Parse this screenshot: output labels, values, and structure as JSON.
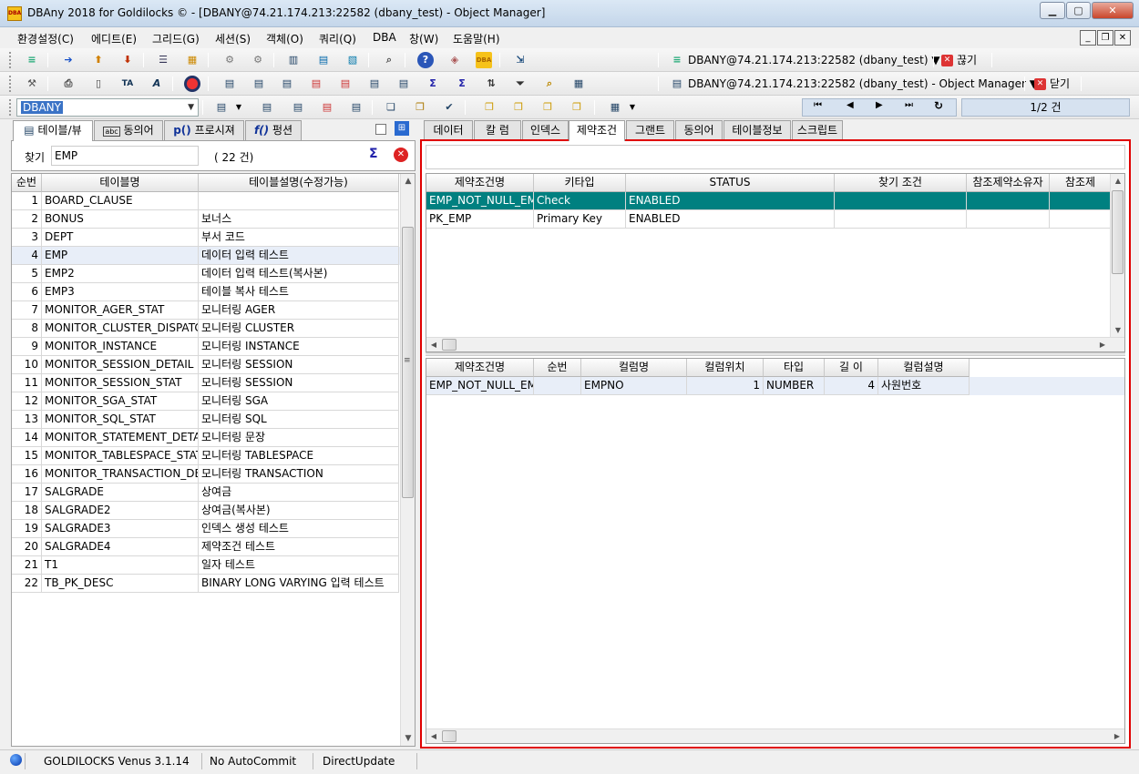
{
  "window": {
    "title": "DBAny 2018 for Goldilocks © - [DBANY@74.21.174.213:22582 (dbany_test) - Object Manager]",
    "app_icon_label": "DBA"
  },
  "menu": [
    "환경설정(C)",
    "에디트(E)",
    "그리드(G)",
    "세션(S)",
    "객체(O)",
    "쿼리(Q)",
    "DBA",
    "창(W)",
    "도움말(H)"
  ],
  "connection": {
    "session_label": "DBANY@74.21.174.213:22582 (dbany_test) ▼",
    "disconnect_label": "끊기",
    "window_label": "DBANY@74.21.174.213:22582 (dbany_test) - Object Manager ▼",
    "close_label": "닫기"
  },
  "schema_combo": {
    "value": "DBANY"
  },
  "pager": {
    "text": "1/2 건"
  },
  "left_tabs": [
    {
      "label": "테이블/뷰"
    },
    {
      "label": "동의어"
    },
    {
      "label": "프로시져"
    },
    {
      "label": "펑션"
    }
  ],
  "search": {
    "label": "찾기",
    "value": "EMP",
    "count": "( 22 건)"
  },
  "table_list": {
    "headers": [
      "순번",
      "테이블명",
      "테이블설명(수정가능)"
    ],
    "rows": [
      [
        "1",
        "BOARD_CLAUSE",
        ""
      ],
      [
        "2",
        "BONUS",
        "보너스"
      ],
      [
        "3",
        "DEPT",
        "부서 코드"
      ],
      [
        "4",
        "EMP",
        "데이터 입력 테스트"
      ],
      [
        "5",
        "EMP2",
        "데이터 입력 테스트(복사본)"
      ],
      [
        "6",
        "EMP3",
        "테이블 복사 테스트"
      ],
      [
        "7",
        "MONITOR_AGER_STAT",
        "모니터링 AGER"
      ],
      [
        "8",
        "MONITOR_CLUSTER_DISPATCH",
        "모니터링 CLUSTER"
      ],
      [
        "9",
        "MONITOR_INSTANCE",
        "모니터링 INSTANCE"
      ],
      [
        "10",
        "MONITOR_SESSION_DETAIL",
        "모니터링 SESSION"
      ],
      [
        "11",
        "MONITOR_SESSION_STAT",
        "모니터링 SESSION"
      ],
      [
        "12",
        "MONITOR_SGA_STAT",
        "모니터링 SGA"
      ],
      [
        "13",
        "MONITOR_SQL_STAT",
        "모니터링 SQL"
      ],
      [
        "14",
        "MONITOR_STATEMENT_DETAIL",
        "모니터링 문장"
      ],
      [
        "15",
        "MONITOR_TABLESPACE_STAT",
        "모니터링 TABLESPACE"
      ],
      [
        "16",
        "MONITOR_TRANSACTION_DETA",
        "모니터링 TRANSACTION"
      ],
      [
        "17",
        "SALGRADE",
        "상여금"
      ],
      [
        "18",
        "SALGRADE2",
        "상여금(복사본)"
      ],
      [
        "19",
        "SALGRADE3",
        "인덱스 생성 테스트"
      ],
      [
        "20",
        "SALGRADE4",
        "제약조건 테스트"
      ],
      [
        "21",
        "T1",
        "일자 테스트"
      ],
      [
        "22",
        "TB_PK_DESC",
        "BINARY LONG VARYING 입력 테스트"
      ]
    ]
  },
  "right_tabs": [
    {
      "label": "데이터"
    },
    {
      "label": "칼 럼"
    },
    {
      "label": "인덱스"
    },
    {
      "label": "제약조건"
    },
    {
      "label": "그랜트"
    },
    {
      "label": "동의어"
    },
    {
      "label": "테이블정보"
    },
    {
      "label": "스크립트"
    }
  ],
  "constraints": {
    "headers": [
      "제약조건명",
      "키타입",
      "STATUS",
      "찾기 조건",
      "참조제약소유자",
      "참조제"
    ],
    "rows": [
      [
        "EMP_NOT_NULL_EMP",
        "Check",
        "ENABLED",
        "",
        "",
        ""
      ],
      [
        "PK_EMP",
        "Primary Key",
        "ENABLED",
        "",
        "",
        ""
      ]
    ]
  },
  "constraint_columns": {
    "headers": [
      "제약조건명",
      "순번",
      "컬럼명",
      "컬럼위치",
      "타입",
      "길 이",
      "컬럼설명"
    ],
    "rows": [
      [
        "EMP_NOT_NULL_EMP",
        "",
        "EMPNO",
        "1",
        "NUMBER",
        "4",
        "사원번호"
      ]
    ]
  },
  "status": {
    "db": "GOLDILOCKS Venus 3.1.14",
    "commit": "No AutoCommit",
    "update": "DirectUpdate"
  },
  "colors": {
    "selected_row": "#008080",
    "highlight_row": "#e8eef8",
    "frame": "#e00000"
  }
}
